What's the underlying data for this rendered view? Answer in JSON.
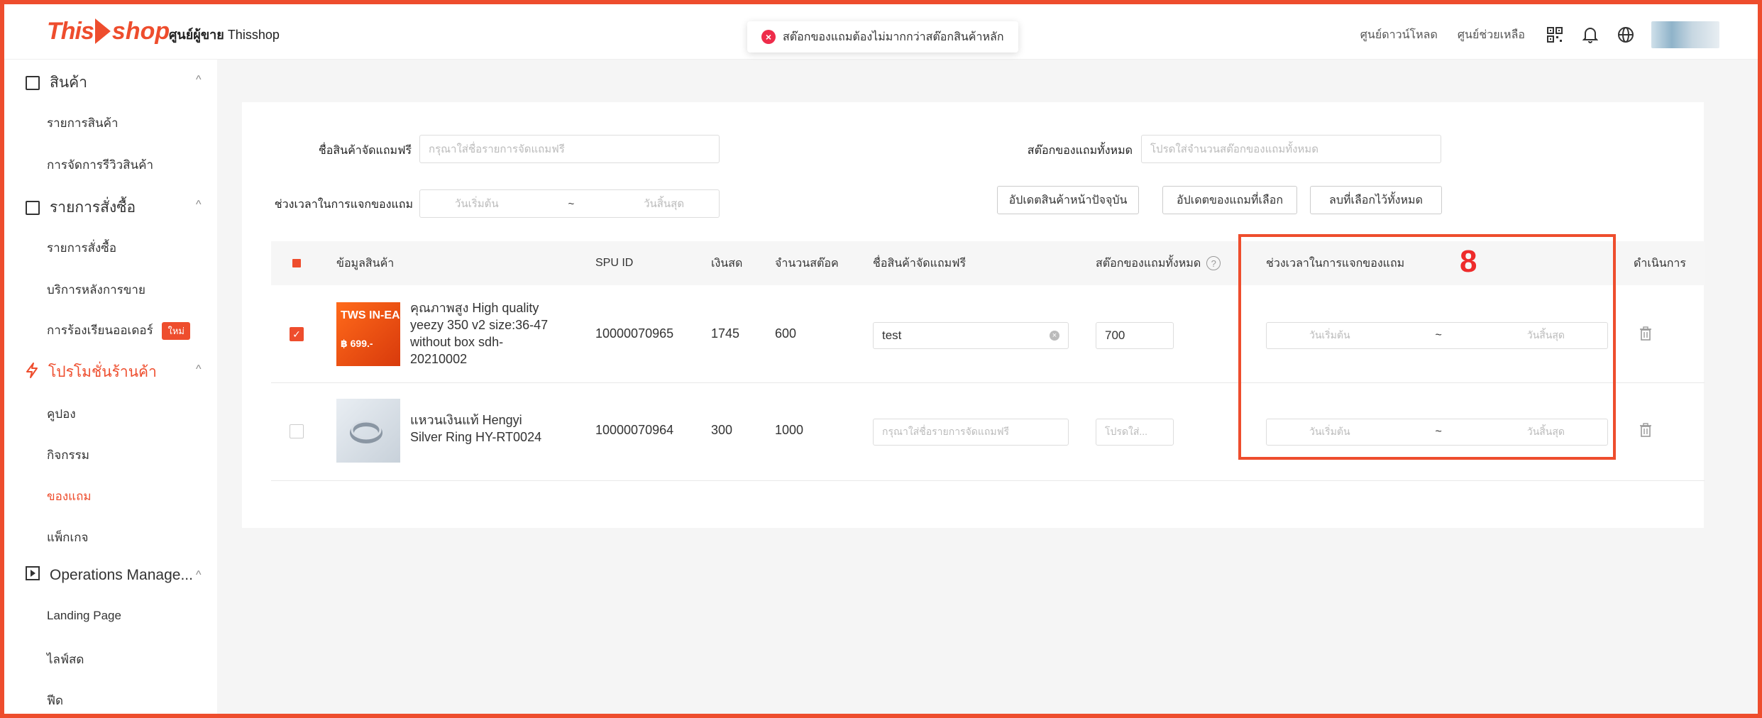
{
  "header": {
    "logo_this": "This",
    "logo_shop": "shop",
    "seller_center": "ศูนย์ผู้ขาย",
    "brand": "Thisshop",
    "toast": "สต๊อกของแถมต้องไม่มากกว่าสต๊อกสินค้าหลัก",
    "download_center": "ศูนย์ดาวน์โหลด",
    "help_center": "ศูนย์ช่วยเหลือ",
    "icons": [
      "qr-code-icon",
      "bell-icon",
      "globe-icon"
    ]
  },
  "sidebar": {
    "groups": [
      {
        "label": "สินค้า",
        "icon": "product-icon",
        "items": [
          "รายการสินค้า",
          "การจัดการรีวิวสินค้า"
        ]
      },
      {
        "label": "รายการสั่งซื้อ",
        "icon": "order-icon",
        "items": [
          "รายการสั่งซื้อ",
          "บริการหลังการขาย",
          "การร้องเรียนออเดอร์"
        ]
      },
      {
        "label": "โปรโมชั่นร้านค้า",
        "icon": "lightning-icon",
        "items": [
          "คูปอง",
          "กิจกรรม",
          "ของแถม",
          "แพ็กเกจ"
        ]
      },
      {
        "label": "Operations Manage...",
        "icon": "play-icon",
        "items": [
          "Landing Page",
          "ไลฟ์สด",
          "ฟีด"
        ]
      }
    ],
    "new_badge": "ใหม่",
    "active_item": "ของแถม"
  },
  "filters": {
    "gift_name_label": "ชื่อสินค้าจัดแถมฟรี",
    "gift_name_placeholder": "กรุณาใส่ชื่อรายการจัดแถมฟรี",
    "total_stock_label": "สต๊อกของแถมทั้งหมด",
    "total_stock_placeholder": "โปรดใส่จำนวนสต๊อกของแถมทั้งหมด",
    "period_label": "ช่วงเวลาในการแจกของแถม",
    "start_placeholder": "วันเริ่มต้น",
    "separator": "~",
    "end_placeholder": "วันสิ้นสุด",
    "btn_update_page": "อัปเดตสินค้าหน้าปัจจุบัน",
    "btn_update_selected": "อัปเดตของแถมที่เลือก",
    "btn_delete_selected": "ลบที่เลือกไว้ทั้งหมด"
  },
  "table": {
    "headers": {
      "product_info": "ข้อมูลสินค้า",
      "spu_id": "SPU ID",
      "price": "เงินสด",
      "stock": "จำนวนสต๊อค",
      "gift_name": "ชื่อสินค้าจัดแถมฟรี",
      "total_gift_stock": "สต๊อกของแถมทั้งหมด",
      "period": "ช่วงเวลาในการแจกของแถม",
      "actions": "ดำเนินการ"
    },
    "rows": [
      {
        "checked": true,
        "thumb_text": "TWS IN-EA",
        "thumb_price": "฿ 699.-",
        "name": "คุณภาพสูง High quality yeezy 350 v2 size:36-47 without box sdh-20210002",
        "spu_id": "10000070965",
        "price": "1745",
        "stock": "600",
        "gift_name": "test",
        "gift_stock": "700",
        "start_placeholder": "วันเริ่มต้น",
        "end_placeholder": "วันสิ้นสุด"
      },
      {
        "checked": false,
        "name": "แหวนเงินแท้ Hengyi Silver Ring HY-RT0024",
        "spu_id": "10000070964",
        "price": "300",
        "stock": "1000",
        "gift_name_placeholder": "กรุณาใส่ชื่อรายการจัดแถมฟรี",
        "gift_stock_placeholder": "โปรดใส่...",
        "start_placeholder": "วันเริ่มต้น",
        "end_placeholder": "วันสิ้นสุด"
      }
    ]
  },
  "annotation": {
    "number": "8"
  },
  "colors": {
    "brand": "#ee4d2d",
    "annotation": "#ee2b2b"
  }
}
